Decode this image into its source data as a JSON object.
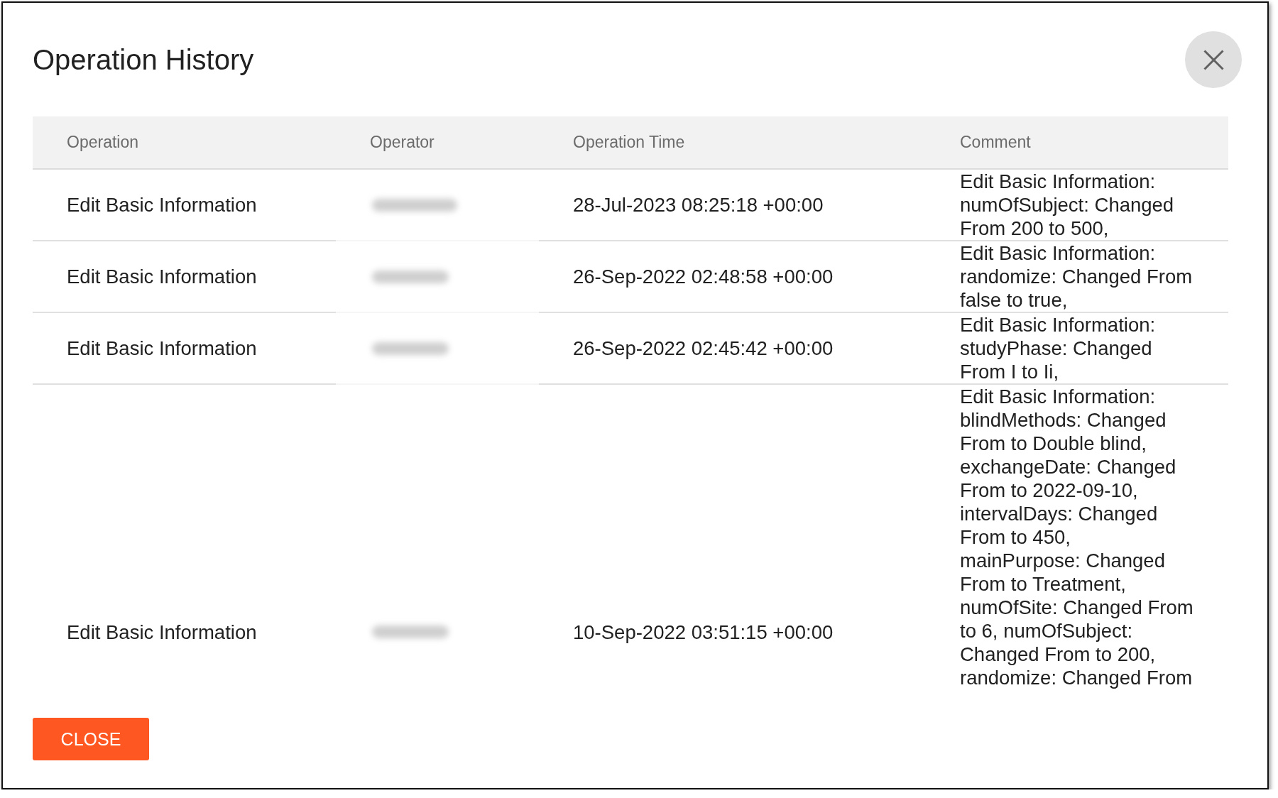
{
  "dialog": {
    "title": "Operation History",
    "table": {
      "columns": [
        "Operation",
        "Operator",
        "Operation Time",
        "Comment"
      ],
      "rows": [
        {
          "operation": "Edit Basic Information",
          "operator_blurred": true,
          "operation_time": "28-Jul-2023 08:25:18 +00:00",
          "comment": "Edit Basic Information: numOfSubject: Changed From 200 to 500,"
        },
        {
          "operation": "Edit Basic Information",
          "operator_blurred": true,
          "operation_time": "26-Sep-2022 02:48:58 +00:00",
          "comment": "Edit Basic Information: randomize: Changed From false to true,"
        },
        {
          "operation": "Edit Basic Information",
          "operator_blurred": true,
          "operation_time": "26-Sep-2022 02:45:42 +00:00",
          "comment": "Edit Basic Information: studyPhase: Changed From I to Ii,"
        },
        {
          "operation": "Edit Basic Information",
          "operator_blurred": true,
          "operation_time": "10-Sep-2022 03:51:15 +00:00",
          "comment": "Edit Basic Information: blindMethods: Changed From to Double blind, exchangeDate: Changed From to 2022-09-10, intervalDays: Changed From to 450, mainPurpose: Changed From to Treatment, numOfSite: Changed From to 6, numOfSubject: Changed From to 200, randomize: Changed From"
        }
      ]
    },
    "buttons": [
      "CLOSE"
    ]
  }
}
